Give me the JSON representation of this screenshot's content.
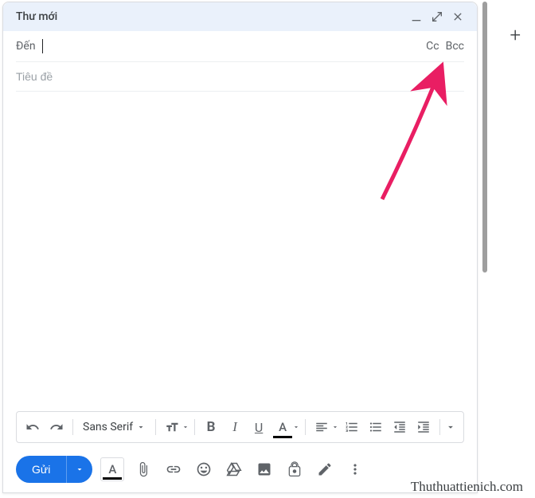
{
  "header": {
    "title": "Thư mới"
  },
  "fields": {
    "to_label": "Đến",
    "cc_label": "Cc",
    "bcc_label": "Bcc",
    "subject_placeholder": "Tiêu đề"
  },
  "format": {
    "font": "Sans Serif"
  },
  "send": {
    "label": "Gửi"
  },
  "watermark": "Thuthuattienich.com"
}
